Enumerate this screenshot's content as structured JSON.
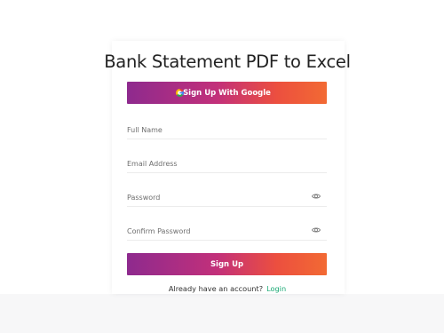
{
  "title": "Bank Statement PDF to Excel",
  "google_button": {
    "label": "Sign Up With Google",
    "icon": "google-icon"
  },
  "fields": {
    "full_name": {
      "placeholder": "Full Name",
      "value": ""
    },
    "email": {
      "placeholder": "Email Address",
      "value": ""
    },
    "password": {
      "placeholder": "Password",
      "value": "",
      "icon": "eye-icon"
    },
    "confirm_password": {
      "placeholder": "Confirm Password",
      "value": "",
      "icon": "eye-icon"
    }
  },
  "signup_button": {
    "label": "Sign Up"
  },
  "footer": {
    "text": "Already have an account?",
    "link": "Login"
  },
  "colors": {
    "gradient_start": "#8e2a8e",
    "gradient_end": "#f26a33",
    "link": "#19a974"
  }
}
